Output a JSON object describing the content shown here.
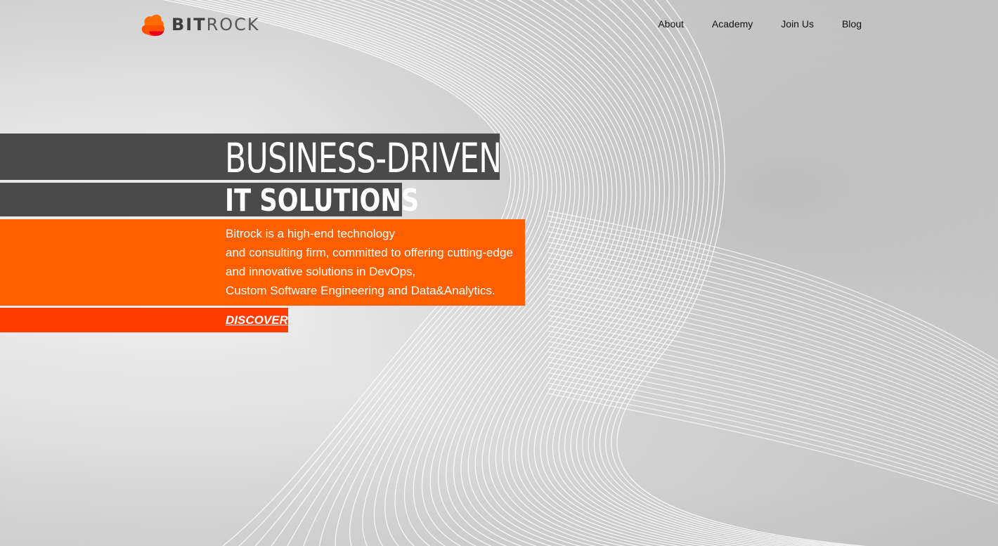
{
  "brand": {
    "name_bold": "BIT",
    "name_light": "ROCK",
    "accent_color": "#ff5f00",
    "cta_color": "#fb3d00",
    "dark_bar_color": "#4a4a4a",
    "logo_icon": "cloud-stack-icon"
  },
  "nav": {
    "items": [
      {
        "label": "About"
      },
      {
        "label": "Academy"
      },
      {
        "label": "Join Us"
      },
      {
        "label": "Blog"
      }
    ]
  },
  "hero": {
    "title_line1": "BUSINESS-DRIVEN",
    "title_line2": "IT SOLUTIONS",
    "description_lines": [
      "Bitrock is a high-end technology",
      "and consulting firm, committed to offering cutting-edge",
      "and innovative solutions in DevOps,",
      "Custom Software Engineering and Data&Analytics."
    ],
    "cta_label": "DISCOVER"
  }
}
